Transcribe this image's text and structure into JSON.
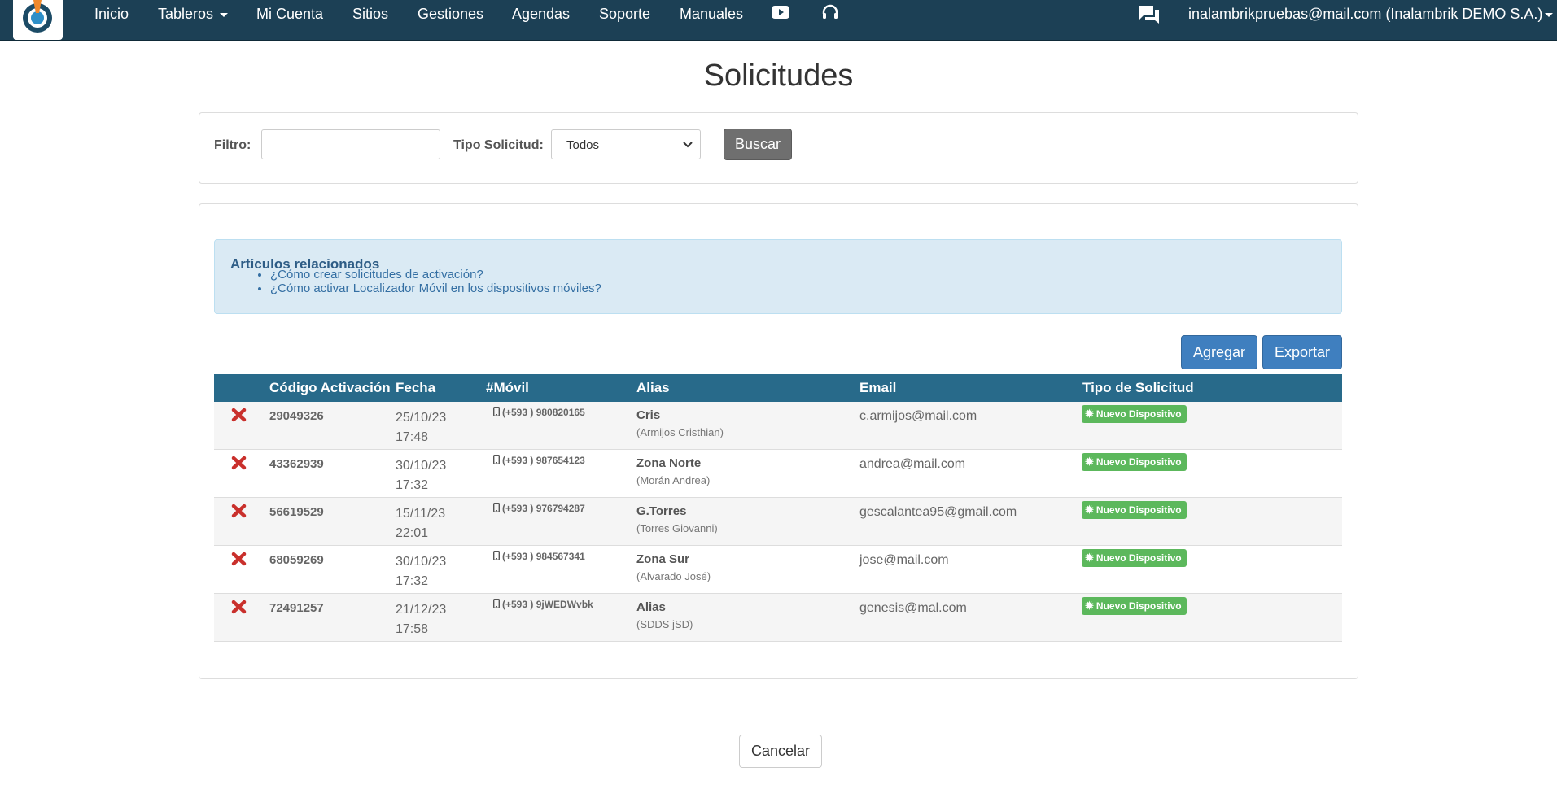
{
  "nav": {
    "items": [
      "Inicio",
      "Tableros",
      "Mi Cuenta",
      "Sitios",
      "Gestiones",
      "Agendas",
      "Soporte",
      "Manuales"
    ],
    "icons": [
      "youtube-icon",
      "headset-icon",
      "chat-icon"
    ],
    "user": "inalambrikpruebas@mail.com (Inalambrik DEMO S.A.)"
  },
  "page": {
    "title": "Solicitudes"
  },
  "filter": {
    "label": "Filtro:",
    "value": "",
    "tipo_label": "Tipo Solicitud:",
    "tipo_value": "Todos",
    "search_button": "Buscar"
  },
  "related": {
    "title": "Artículos relacionados",
    "links": [
      "¿Cómo crear solicitudes de activación?",
      "¿Cómo activar Localizador Móvil en los dispositivos móviles?"
    ]
  },
  "actions": {
    "add": "Agregar",
    "export": "Exportar"
  },
  "table": {
    "headers": [
      "Código Activación",
      "Fecha",
      "#Móvil",
      "Alias",
      "Email",
      "Tipo de Solicitud"
    ],
    "rows": [
      {
        "code": "29049326",
        "date": "25/10/23",
        "time": "17:48",
        "phone": "(+593 ) 980820165",
        "alias": "Cris",
        "alias_sub": "(Armijos Cristhian)",
        "email": "c.armijos@mail.com",
        "type": "Nuevo Dispositivo"
      },
      {
        "code": "43362939",
        "date": "30/10/23",
        "time": "17:32",
        "phone": "(+593 ) 987654123",
        "alias": "Zona Norte",
        "alias_sub": "(Morán Andrea)",
        "email": "andrea@mail.com",
        "type": "Nuevo Dispositivo"
      },
      {
        "code": "56619529",
        "date": "15/11/23",
        "time": "22:01",
        "phone": "(+593 ) 976794287",
        "alias": "G.Torres",
        "alias_sub": "(Torres Giovanni)",
        "email": "gescalantea95@gmail.com",
        "type": "Nuevo Dispositivo"
      },
      {
        "code": "68059269",
        "date": "30/10/23",
        "time": "17:32",
        "phone": "(+593 ) 984567341",
        "alias": "Zona Sur",
        "alias_sub": "(Alvarado José)",
        "email": "jose@mail.com",
        "type": "Nuevo Dispositivo"
      },
      {
        "code": "72491257",
        "date": "21/12/23",
        "time": "17:58",
        "phone": "(+593 ) 9jWEDWvbk",
        "alias": "Alias",
        "alias_sub": "(SDDS jSD)",
        "email": "genesis@mal.com",
        "type": "Nuevo Dispositivo"
      }
    ]
  },
  "footer": {
    "cancel": "Cancelar"
  },
  "colors": {
    "navbar": "#1c4055",
    "table_header": "#286a8a",
    "primary_button": "#3f7fbf",
    "badge_success": "#5cb85c",
    "delete_icon": "#c9302c"
  }
}
